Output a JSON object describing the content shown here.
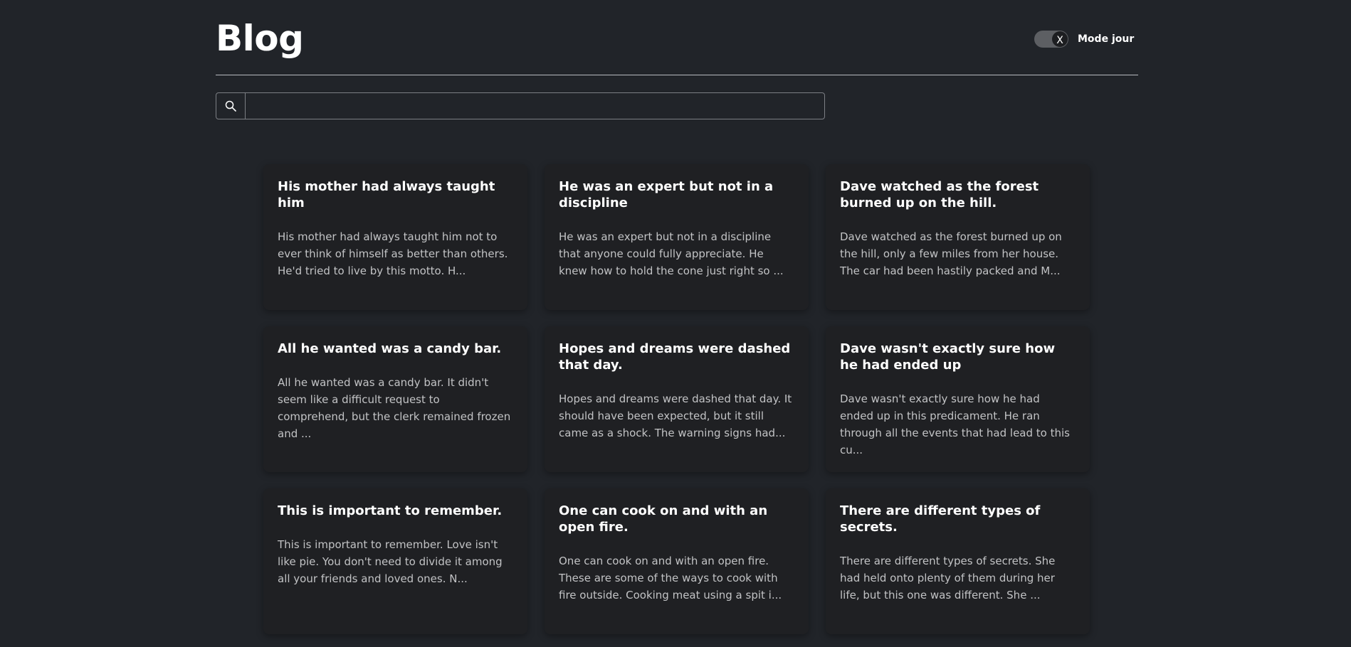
{
  "header": {
    "title": "Blog",
    "theme_toggle": {
      "knob_text": "X",
      "label": "Mode jour"
    }
  },
  "search": {
    "icon": "search-icon",
    "value": "",
    "placeholder": ""
  },
  "posts": [
    {
      "title": "His mother had always taught him",
      "excerpt": "His mother had always taught him not to ever think of himself as better than others. He'd tried to live by this motto. H..."
    },
    {
      "title": "He was an expert but not in a discipline",
      "excerpt": "He was an expert but not in a discipline that anyone could fully appreciate. He knew how to hold the cone just right so ..."
    },
    {
      "title": "Dave watched as the forest burned up on the hill.",
      "excerpt": "Dave watched as the forest burned up on the hill, only a few miles from her house. The car had been hastily packed and M..."
    },
    {
      "title": "All he wanted was a candy bar.",
      "excerpt": "All he wanted was a candy bar. It didn't seem like a difficult request to comprehend, but the clerk remained frozen and ..."
    },
    {
      "title": "Hopes and dreams were dashed that day.",
      "excerpt": "Hopes and dreams were dashed that day. It should have been expected, but it still came as a shock. The warning signs had..."
    },
    {
      "title": "Dave wasn't exactly sure how he had ended up",
      "excerpt": "Dave wasn't exactly sure how he had ended up in this predicament. He ran through all the events that had lead to this cu..."
    },
    {
      "title": "This is important to remember.",
      "excerpt": "This is important to remember. Love isn't like pie. You don't need to divide it among all your friends and loved ones. N..."
    },
    {
      "title": "One can cook on and with an open fire.",
      "excerpt": "One can cook on and with an open fire. These are some of the ways to cook with fire outside. Cooking meat using a spit i..."
    },
    {
      "title": "There are different types of secrets.",
      "excerpt": "There are different types of secrets. She had held onto plenty of them during her life, but this one was different. She ..."
    }
  ]
}
